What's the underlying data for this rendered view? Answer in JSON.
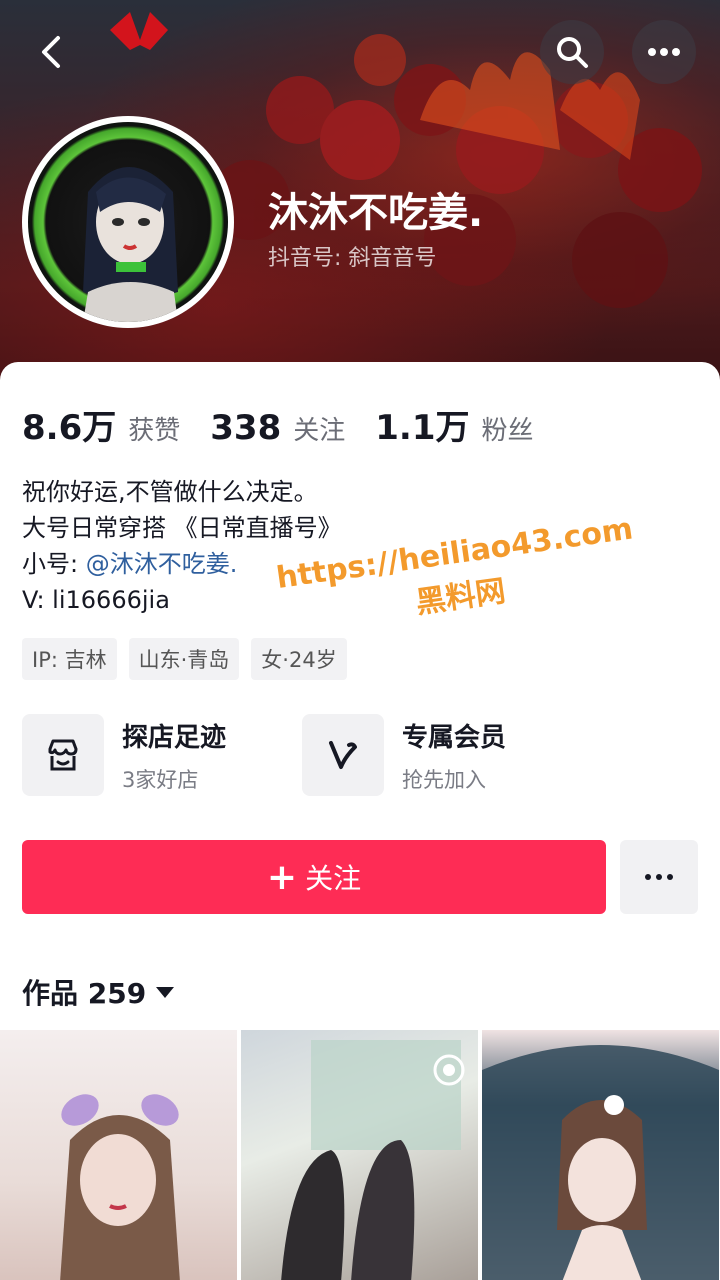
{
  "header": {
    "nickname": "沐沐不吃姜.",
    "douyin_id": "抖音号: 斜音音号"
  },
  "stats": [
    {
      "value": "8.6万",
      "label": "获赞"
    },
    {
      "value": "338",
      "label": "关注"
    },
    {
      "value": "1.1万",
      "label": "粉丝"
    }
  ],
  "bio": {
    "line1": "祝你好运,不管做什么决定。",
    "line2": "大号日常穿搭 《日常直播号》",
    "line3_prefix": "小号: ",
    "line3_link": "@沐沐不吃姜.",
    "line4": "V:  li16666jia"
  },
  "tags": [
    "IP: 吉林",
    "山东·青岛",
    "女·24岁"
  ],
  "features": [
    {
      "title": "探店足迹",
      "subtitle": "3家好店",
      "icon": "store-icon"
    },
    {
      "title": "专属会员",
      "subtitle": "抢先加入",
      "icon": "vip-v-icon"
    }
  ],
  "actions": {
    "follow_label": "关注"
  },
  "works": {
    "label": "作品 259"
  },
  "watermark": {
    "line1": "https://heiliao43.com",
    "line2": "黑料网"
  },
  "colors": {
    "accent": "#fe2c55",
    "link": "#2f5f9e",
    "watermark": "#f39a2c"
  }
}
